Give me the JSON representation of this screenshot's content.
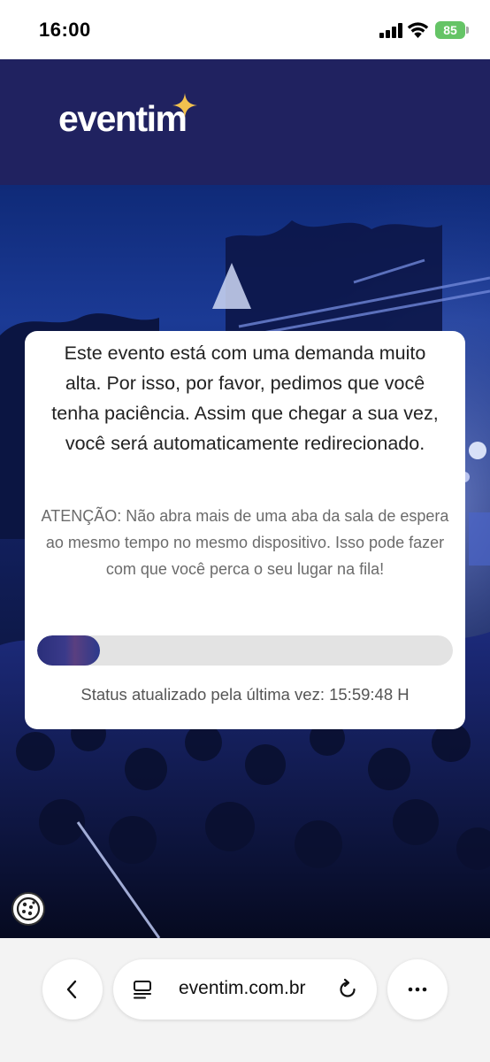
{
  "status_bar": {
    "time": "16:00",
    "battery": "85"
  },
  "header": {
    "logo_text": "eventim"
  },
  "dialog": {
    "message": "Este evento está com uma demanda muito alta. Por isso, por favor, pedimos que você tenha paciência. Assim que chegar a sua vez, você será automaticamente redirecionado.",
    "warning": "ATENÇÃO: Não abra mais de uma aba da sala de espera ao mesmo tempo no mesmo dispositivo. Isso pode fazer com que você perca o seu lugar na fila!",
    "progress_fraction": 0.15,
    "status_text": "Status atualizado pela última vez: 15:59:48 H"
  },
  "toolbar": {
    "url": "eventim.com.br"
  },
  "icons": {
    "back": "chevron-left-icon",
    "reader": "reader-mode-icon",
    "reload": "reload-icon",
    "more": "more-dots-icon",
    "cookie": "cookie-icon",
    "logo_star": "sparkle-icon"
  },
  "colors": {
    "brand_navy": "#202260",
    "logo_star": "#f2c14e",
    "battery_green": "#65c466",
    "progress_track": "#e3e3e3",
    "progress_fill": "#2a2f7a"
  }
}
